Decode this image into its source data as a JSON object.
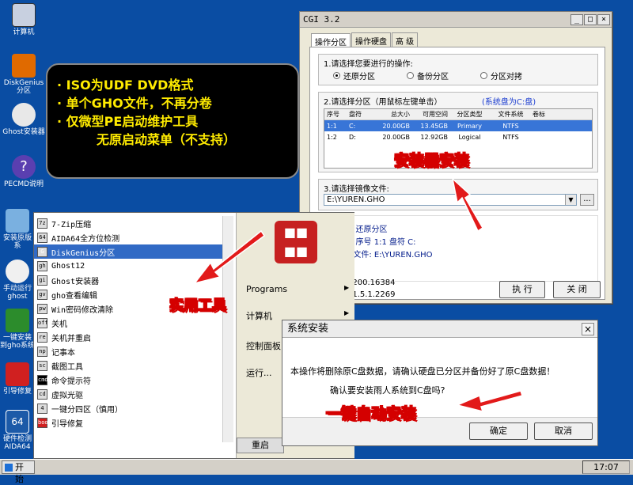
{
  "desktop": {
    "icons": [
      "计算机",
      "DiskGenius分区",
      "Ghost安装器",
      "PECMD说明",
      "安装原版系",
      "手动运行ghost",
      "一键安装到gho系统",
      "引导修复",
      "硬件检测AIDA64"
    ]
  },
  "cgi": {
    "title": "CGI 3.2",
    "tabs": [
      "操作分区",
      "操作硬盘",
      "高 级"
    ],
    "step1_title": "1.请选择您要进行的操作:",
    "ops": [
      "还原分区",
      "备份分区",
      "分区对拷"
    ],
    "step2_title": "2.请选择分区（用鼠标左键单击）",
    "system_disk": "(系统盘为C:盘)",
    "table_headers": [
      "序号",
      "盘符",
      "总大小",
      "可用空间",
      "分区类型",
      "文件系统",
      "卷标"
    ],
    "rows": [
      [
        "1:1",
        "C:",
        "20.00GB",
        "13.45GB",
        "Primary",
        "NTFS",
        ""
      ],
      [
        "1:2",
        "D:",
        "20.00GB",
        "12.92GB",
        "Logical",
        "NTFS",
        ""
      ]
    ],
    "step3_title": "3.请选择镜像文件:",
    "image_path": "E:\\YUREN.GHO",
    "browse": "...",
    "op_line": "作: 还原分区",
    "part_line": "区:  序号 1:1       盘符 C:",
    "file_line": "录/文件: E:\\YUREN.GHO",
    "ver1": "9200.16384",
    "ver2": "11.5.1.2269",
    "exec": "执 行",
    "close": "关 闭"
  },
  "note": {
    "lines": [
      "· ISO为UDF DVD格式",
      "· 单个GHO文件，不再分卷",
      "· 仅微型PE启动维护工具",
      "无原启动菜单（不支持）"
    ]
  },
  "labels": {
    "installer": "安装器安装",
    "tools": "实用工具",
    "oneclick": "一键自动安装"
  },
  "menu": {
    "items": [
      "7-Zip压缩",
      "AIDA64全方位检测",
      "DiskGenius分区",
      "Ghost12",
      "Ghost安装器",
      "gho查看编辑",
      "Win密码修改清除",
      "关机",
      "关机并重启",
      "记事本",
      "截图工具",
      "命令提示符",
      "虚拟光驱",
      "一键分四区（慎用）",
      "引导修复"
    ],
    "icons": [
      "7z",
      "64",
      "G",
      "gh",
      "gi",
      "gv",
      "pw",
      "off",
      "re",
      "np",
      "sc",
      "cmd",
      "cd",
      "4",
      "boot"
    ],
    "programs": "Programs",
    "computer": "计算机",
    "control": "控制面板",
    "run": "运行...",
    "restart": "重启"
  },
  "dialog": {
    "title": "系统安装",
    "line1": "本操作将删除原C盘数据，请确认硬盘已分区并备份好了原C盘数据！",
    "line2": "确认要安装雨人系统到C盘吗?",
    "ok": "确定",
    "cancel": "取消"
  },
  "taskbar": {
    "start": "开 始",
    "time": "17:07"
  }
}
